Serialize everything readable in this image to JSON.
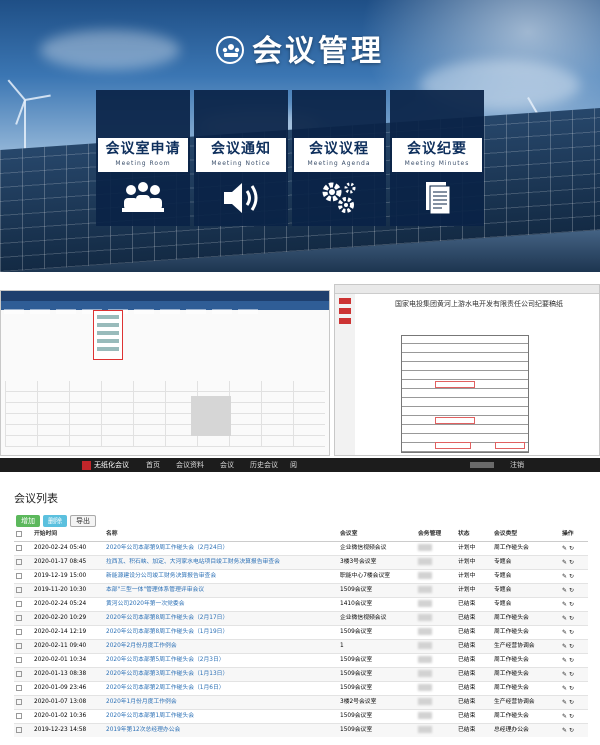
{
  "hero": {
    "title": "会议管理",
    "tiles": [
      {
        "label": "会议室申请",
        "sub": "Meeting Room",
        "icon": "people-icon"
      },
      {
        "label": "会议通知",
        "sub": "Meeting Notice",
        "icon": "speaker-icon"
      },
      {
        "label": "会议议程",
        "sub": "Meeting Agenda",
        "icon": "gears-icon"
      },
      {
        "label": "会议纪要",
        "sub": "Meeting Minutes",
        "icon": "document-icon"
      }
    ]
  },
  "minutes_doc": {
    "title": "国家电投集团黄河上游水电开发有限责任公司纪要稿纸"
  },
  "app": {
    "logo_text": "无纸化会议",
    "logo_sub": "Paperless Meeting",
    "nav": [
      "首页",
      "会议资料",
      "会议",
      "历史会议",
      "阅"
    ],
    "logout": "注销",
    "list_title": "会议列表",
    "buttons": {
      "add": "增加",
      "delete": "删除",
      "export": "导出"
    },
    "columns": [
      "开始时间",
      "名称",
      "会议室",
      "会务管理",
      "状态",
      "会议类型",
      "操作"
    ],
    "rows": [
      {
        "time": "2020-02-24 05:40",
        "name": "2020年公司本部第9周工作碰头会（2月24日）",
        "room": "企业微信视频会议",
        "status": "计划中",
        "type": "周工作碰头会"
      },
      {
        "time": "2020-01-17 08:45",
        "name": "拉西瓦、积石峡、加定、大河家水电站项目竣工财务决算报告审查会",
        "room": "3楼3号会议室",
        "status": "计划中",
        "type": "专题会"
      },
      {
        "time": "2019-12-19 15:00",
        "name": "新能源建设分公司竣工财务决算报告审查会",
        "room": "职能中心7楼会议室",
        "status": "计划中",
        "type": "专题会"
      },
      {
        "time": "2019-11-20 10:30",
        "name": "本部\"三型一体\"管理体系管理评审会议",
        "room": "1509会议室",
        "status": "计划中",
        "type": "专题会"
      },
      {
        "time": "2020-02-24 05:24",
        "name": "黄河公司2020年第一次党委会",
        "room": "1410会议室",
        "status": "已结束",
        "type": "专题会"
      },
      {
        "time": "2020-02-20 10:29",
        "name": "2020年公司本部第8周工作碰头会（2月17日）",
        "room": "企业微信视频会议",
        "status": "已结束",
        "type": "周工作碰头会"
      },
      {
        "time": "2020-02-14 12:19",
        "name": "2020年公司本部第8周工作碰头会（1月19日）",
        "room": "1509会议室",
        "status": "已结束",
        "type": "周工作碰头会"
      },
      {
        "time": "2020-02-11 09:40",
        "name": "2020年2月份月度工作例会",
        "room": "1",
        "status": "已结束",
        "type": "生产经营协调会"
      },
      {
        "time": "2020-02-01 10:34",
        "name": "2020年公司本部第5周工作碰头会（2月3日）",
        "room": "1509会议室",
        "status": "已结束",
        "type": "周工作碰头会"
      },
      {
        "time": "2020-01-13 08:38",
        "name": "2020年公司本部第3周工作碰头会（1月13日）",
        "room": "1509会议室",
        "status": "已结束",
        "type": "周工作碰头会"
      },
      {
        "time": "2020-01-09 23:46",
        "name": "2020年公司本部第2周工作碰头会（1月6日）",
        "room": "1509会议室",
        "status": "已结束",
        "type": "周工作碰头会"
      },
      {
        "time": "2020-01-07 13:08",
        "name": "2020年1月份月度工作例会",
        "room": "3楼2号会议室",
        "status": "已结束",
        "type": "生产经营协调会"
      },
      {
        "time": "2020-01-02 10:36",
        "name": "2020年公司本部第1周工作碰头会",
        "room": "1509会议室",
        "status": "已结束",
        "type": "周工作碰头会"
      },
      {
        "time": "2019-12-23 14:58",
        "name": "2019年第12次总经理办公会",
        "room": "1509会议室",
        "status": "已结束",
        "type": "总经理办公会"
      }
    ]
  },
  "colors": {
    "hero_tile": "#0a2346",
    "link": "#2a6fb5",
    "btn_add": "#5cb85c",
    "btn_del": "#5bc0de",
    "topbar": "#1c1c1c"
  }
}
